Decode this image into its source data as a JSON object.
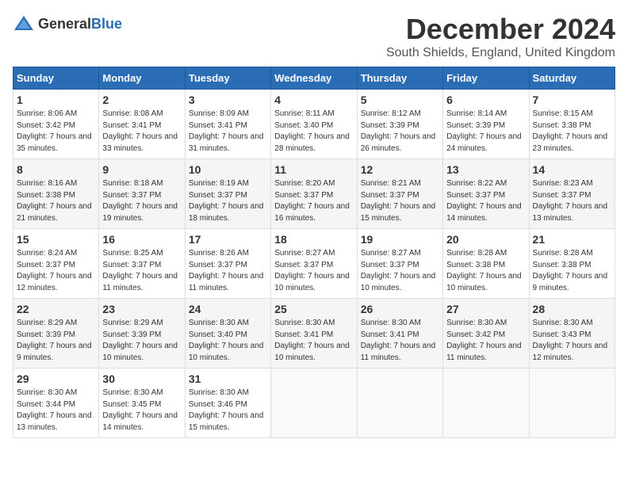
{
  "logo": {
    "general": "General",
    "blue": "Blue"
  },
  "title": "December 2024",
  "subtitle": "South Shields, England, United Kingdom",
  "days_of_week": [
    "Sunday",
    "Monday",
    "Tuesday",
    "Wednesday",
    "Thursday",
    "Friday",
    "Saturday"
  ],
  "weeks": [
    [
      {
        "day": 1,
        "sunrise": "8:06 AM",
        "sunset": "3:42 PM",
        "daylight": "7 hours and 35 minutes."
      },
      {
        "day": 2,
        "sunrise": "8:08 AM",
        "sunset": "3:41 PM",
        "daylight": "7 hours and 33 minutes."
      },
      {
        "day": 3,
        "sunrise": "8:09 AM",
        "sunset": "3:41 PM",
        "daylight": "7 hours and 31 minutes."
      },
      {
        "day": 4,
        "sunrise": "8:11 AM",
        "sunset": "3:40 PM",
        "daylight": "7 hours and 28 minutes."
      },
      {
        "day": 5,
        "sunrise": "8:12 AM",
        "sunset": "3:39 PM",
        "daylight": "7 hours and 26 minutes."
      },
      {
        "day": 6,
        "sunrise": "8:14 AM",
        "sunset": "3:39 PM",
        "daylight": "7 hours and 24 minutes."
      },
      {
        "day": 7,
        "sunrise": "8:15 AM",
        "sunset": "3:38 PM",
        "daylight": "7 hours and 23 minutes."
      }
    ],
    [
      {
        "day": 8,
        "sunrise": "8:16 AM",
        "sunset": "3:38 PM",
        "daylight": "7 hours and 21 minutes."
      },
      {
        "day": 9,
        "sunrise": "8:18 AM",
        "sunset": "3:37 PM",
        "daylight": "7 hours and 19 minutes."
      },
      {
        "day": 10,
        "sunrise": "8:19 AM",
        "sunset": "3:37 PM",
        "daylight": "7 hours and 18 minutes."
      },
      {
        "day": 11,
        "sunrise": "8:20 AM",
        "sunset": "3:37 PM",
        "daylight": "7 hours and 16 minutes."
      },
      {
        "day": 12,
        "sunrise": "8:21 AM",
        "sunset": "3:37 PM",
        "daylight": "7 hours and 15 minutes."
      },
      {
        "day": 13,
        "sunrise": "8:22 AM",
        "sunset": "3:37 PM",
        "daylight": "7 hours and 14 minutes."
      },
      {
        "day": 14,
        "sunrise": "8:23 AM",
        "sunset": "3:37 PM",
        "daylight": "7 hours and 13 minutes."
      }
    ],
    [
      {
        "day": 15,
        "sunrise": "8:24 AM",
        "sunset": "3:37 PM",
        "daylight": "7 hours and 12 minutes."
      },
      {
        "day": 16,
        "sunrise": "8:25 AM",
        "sunset": "3:37 PM",
        "daylight": "7 hours and 11 minutes."
      },
      {
        "day": 17,
        "sunrise": "8:26 AM",
        "sunset": "3:37 PM",
        "daylight": "7 hours and 11 minutes."
      },
      {
        "day": 18,
        "sunrise": "8:27 AM",
        "sunset": "3:37 PM",
        "daylight": "7 hours and 10 minutes."
      },
      {
        "day": 19,
        "sunrise": "8:27 AM",
        "sunset": "3:37 PM",
        "daylight": "7 hours and 10 minutes."
      },
      {
        "day": 20,
        "sunrise": "8:28 AM",
        "sunset": "3:38 PM",
        "daylight": "7 hours and 10 minutes."
      },
      {
        "day": 21,
        "sunrise": "8:28 AM",
        "sunset": "3:38 PM",
        "daylight": "7 hours and 9 minutes."
      }
    ],
    [
      {
        "day": 22,
        "sunrise": "8:29 AM",
        "sunset": "3:39 PM",
        "daylight": "7 hours and 9 minutes."
      },
      {
        "day": 23,
        "sunrise": "8:29 AM",
        "sunset": "3:39 PM",
        "daylight": "7 hours and 10 minutes."
      },
      {
        "day": 24,
        "sunrise": "8:30 AM",
        "sunset": "3:40 PM",
        "daylight": "7 hours and 10 minutes."
      },
      {
        "day": 25,
        "sunrise": "8:30 AM",
        "sunset": "3:41 PM",
        "daylight": "7 hours and 10 minutes."
      },
      {
        "day": 26,
        "sunrise": "8:30 AM",
        "sunset": "3:41 PM",
        "daylight": "7 hours and 11 minutes."
      },
      {
        "day": 27,
        "sunrise": "8:30 AM",
        "sunset": "3:42 PM",
        "daylight": "7 hours and 11 minutes."
      },
      {
        "day": 28,
        "sunrise": "8:30 AM",
        "sunset": "3:43 PM",
        "daylight": "7 hours and 12 minutes."
      }
    ],
    [
      {
        "day": 29,
        "sunrise": "8:30 AM",
        "sunset": "3:44 PM",
        "daylight": "7 hours and 13 minutes."
      },
      {
        "day": 30,
        "sunrise": "8:30 AM",
        "sunset": "3:45 PM",
        "daylight": "7 hours and 14 minutes."
      },
      {
        "day": 31,
        "sunrise": "8:30 AM",
        "sunset": "3:46 PM",
        "daylight": "7 hours and 15 minutes."
      },
      null,
      null,
      null,
      null
    ]
  ]
}
